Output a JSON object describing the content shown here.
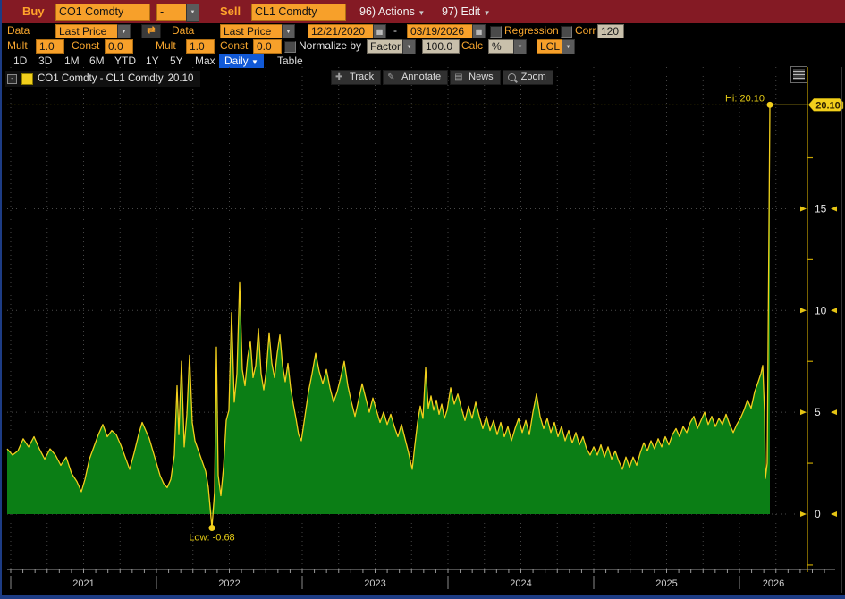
{
  "toolbar_row1": {
    "buy_label": "Buy",
    "buy_value": "CO1 Comdty",
    "spread_operator": "-",
    "sell_label": "Sell",
    "sell_value": "CL1 Comdty",
    "actions_label": "96) Actions",
    "edit_label": "97) Edit"
  },
  "toolbar_row2": {
    "data1_label": "Data",
    "data1_value": "Last Price",
    "swap_icon": "⇄",
    "data2_label": "Data",
    "data2_value": "Last Price",
    "date_from": "12/21/2020",
    "date_separator": "-",
    "date_to": "03/19/2026",
    "regression_label": "Regression",
    "corr_label": "Corr",
    "corr_value": "120"
  },
  "toolbar_row3": {
    "mult1_label": "Mult",
    "mult1_value": "1.0",
    "const1_label": "Const",
    "const1_value": "0.0",
    "mult2_label": "Mult",
    "mult2_value": "1.0",
    "const2_label": "Const",
    "const2_value": "0.0",
    "normalize_label": "Normalize by",
    "normalize_value": "Factor",
    "factor_value": "100.0",
    "calc_label": "Calc",
    "calc_value": "%",
    "lcl_value": "LCL"
  },
  "range_tabs": {
    "items": [
      "1D",
      "3D",
      "1M",
      "6M",
      "YTD",
      "1Y",
      "5Y",
      "Max"
    ],
    "period_selected": "Daily",
    "table_label": "Table"
  },
  "chart_toolbar": {
    "track_label": "Track",
    "annotate_label": "Annotate",
    "news_label": "News",
    "zoom_label": "Zoom"
  },
  "legend": {
    "series_label": "CO1 Comdty - CL1 Comdty",
    "last_value": "20.10"
  },
  "chart_data": {
    "type": "area",
    "title": "CO1 Comdty - CL1 Comdty spread (Brent minus WTI front-month)",
    "x_range": [
      "12/21/2020",
      "03/19/2026"
    ],
    "years": [
      "2021",
      "2022",
      "2023",
      "2024",
      "2025",
      "2026"
    ],
    "y_ticks": [
      0,
      5,
      10,
      15
    ],
    "y_minor_ticks": [
      -2.5,
      2.5,
      7.5,
      12.5,
      17.5
    ],
    "ylim": [
      -2.7,
      21.9
    ],
    "grid": "quarterly-vertical, major-horizontal, dotted",
    "hi": {
      "label": "Hi: 20.10",
      "value": 20.1,
      "axis_tag": "20.10"
    },
    "low": {
      "label": "Low: -0.68",
      "value": -0.68
    },
    "last_value": 20.1,
    "line_color": "#f2cf1c",
    "fill_color": "#0b7e15",
    "axis_color": "#c7a400",
    "points": [
      [
        0,
        3.2
      ],
      [
        6,
        2.9
      ],
      [
        12,
        3.1
      ],
      [
        18,
        3.7
      ],
      [
        24,
        3.3
      ],
      [
        30,
        3.8
      ],
      [
        36,
        3.2
      ],
      [
        42,
        2.7
      ],
      [
        48,
        3.2
      ],
      [
        54,
        2.9
      ],
      [
        60,
        2.4
      ],
      [
        66,
        2.8
      ],
      [
        72,
        2.0
      ],
      [
        78,
        1.6
      ],
      [
        83,
        1.1
      ],
      [
        87,
        1.7
      ],
      [
        92,
        2.7
      ],
      [
        97,
        3.3
      ],
      [
        102,
        3.9
      ],
      [
        107,
        4.4
      ],
      [
        112,
        3.8
      ],
      [
        117,
        4.1
      ],
      [
        122,
        3.9
      ],
      [
        127,
        3.4
      ],
      [
        132,
        2.8
      ],
      [
        137,
        2.2
      ],
      [
        142,
        3.0
      ],
      [
        147,
        3.9
      ],
      [
        151,
        4.5
      ],
      [
        155,
        4.1
      ],
      [
        159,
        3.7
      ],
      [
        163,
        3.1
      ],
      [
        167,
        2.5
      ],
      [
        171,
        1.9
      ],
      [
        175,
        1.5
      ],
      [
        179,
        1.3
      ],
      [
        183,
        1.7
      ],
      [
        187,
        2.9
      ],
      [
        190,
        6.3
      ],
      [
        192,
        3.9
      ],
      [
        195,
        7.5
      ],
      [
        198,
        3.3
      ],
      [
        201,
        4.9
      ],
      [
        204,
        7.8
      ],
      [
        207,
        4.5
      ],
      [
        210,
        3.6
      ],
      [
        214,
        3.1
      ],
      [
        218,
        2.6
      ],
      [
        222,
        2.1
      ],
      [
        225,
        1.3
      ],
      [
        229,
        -0.68
      ],
      [
        232,
        1.1
      ],
      [
        234,
        8.2
      ],
      [
        236,
        1.9
      ],
      [
        239,
        0.9
      ],
      [
        242,
        2.3
      ],
      [
        245,
        4.6
      ],
      [
        248,
        5.1
      ],
      [
        251,
        9.9
      ],
      [
        254,
        5.5
      ],
      [
        257,
        6.9
      ],
      [
        260,
        11.4
      ],
      [
        263,
        7.1
      ],
      [
        266,
        6.3
      ],
      [
        269,
        7.7
      ],
      [
        272,
        8.5
      ],
      [
        275,
        6.7
      ],
      [
        278,
        7.3
      ],
      [
        281,
        9.1
      ],
      [
        284,
        6.9
      ],
      [
        287,
        6.1
      ],
      [
        290,
        7.1
      ],
      [
        293,
        8.9
      ],
      [
        296,
        7.4
      ],
      [
        299,
        6.7
      ],
      [
        302,
        7.9
      ],
      [
        305,
        8.8
      ],
      [
        308,
        7.3
      ],
      [
        311,
        6.5
      ],
      [
        314,
        7.4
      ],
      [
        317,
        6.2
      ],
      [
        320,
        5.4
      ],
      [
        323,
        4.7
      ],
      [
        326,
        3.9
      ],
      [
        329,
        3.6
      ],
      [
        333,
        4.8
      ],
      [
        337,
        6.0
      ],
      [
        341,
        6.9
      ],
      [
        345,
        7.9
      ],
      [
        349,
        7.0
      ],
      [
        353,
        6.4
      ],
      [
        357,
        7.1
      ],
      [
        361,
        6.2
      ],
      [
        365,
        5.5
      ],
      [
        369,
        6.0
      ],
      [
        373,
        6.7
      ],
      [
        377,
        7.5
      ],
      [
        381,
        6.3
      ],
      [
        385,
        5.5
      ],
      [
        389,
        4.8
      ],
      [
        393,
        5.6
      ],
      [
        397,
        6.4
      ],
      [
        401,
        5.7
      ],
      [
        405,
        5.0
      ],
      [
        409,
        5.7
      ],
      [
        413,
        5.1
      ],
      [
        417,
        4.5
      ],
      [
        421,
        5.0
      ],
      [
        425,
        4.4
      ],
      [
        429,
        4.9
      ],
      [
        433,
        4.3
      ],
      [
        437,
        3.8
      ],
      [
        441,
        4.4
      ],
      [
        445,
        3.7
      ],
      [
        449,
        3.0
      ],
      [
        453,
        2.2
      ],
      [
        456,
        3.4
      ],
      [
        459,
        4.5
      ],
      [
        462,
        5.3
      ],
      [
        465,
        4.7
      ],
      [
        468,
        7.2
      ],
      [
        471,
        5.2
      ],
      [
        474,
        5.8
      ],
      [
        477,
        5.1
      ],
      [
        480,
        5.6
      ],
      [
        483,
        4.9
      ],
      [
        486,
        5.4
      ],
      [
        489,
        4.7
      ],
      [
        492,
        5.1
      ],
      [
        496,
        6.2
      ],
      [
        500,
        5.4
      ],
      [
        504,
        5.9
      ],
      [
        508,
        5.2
      ],
      [
        512,
        4.6
      ],
      [
        516,
        5.3
      ],
      [
        520,
        4.7
      ],
      [
        524,
        5.5
      ],
      [
        528,
        4.8
      ],
      [
        532,
        4.2
      ],
      [
        536,
        4.8
      ],
      [
        540,
        4.1
      ],
      [
        544,
        4.6
      ],
      [
        548,
        3.9
      ],
      [
        552,
        4.5
      ],
      [
        556,
        3.8
      ],
      [
        560,
        4.3
      ],
      [
        564,
        3.6
      ],
      [
        568,
        4.2
      ],
      [
        572,
        4.7
      ],
      [
        576,
        4.0
      ],
      [
        580,
        4.6
      ],
      [
        584,
        3.9
      ],
      [
        588,
        5.0
      ],
      [
        592,
        5.9
      ],
      [
        596,
        4.8
      ],
      [
        600,
        4.2
      ],
      [
        604,
        4.7
      ],
      [
        608,
        4.0
      ],
      [
        612,
        4.5
      ],
      [
        616,
        3.8
      ],
      [
        620,
        4.3
      ],
      [
        624,
        3.6
      ],
      [
        628,
        4.1
      ],
      [
        632,
        3.5
      ],
      [
        636,
        4.0
      ],
      [
        640,
        3.4
      ],
      [
        644,
        3.8
      ],
      [
        648,
        3.2
      ],
      [
        652,
        2.9
      ],
      [
        656,
        3.3
      ],
      [
        660,
        2.9
      ],
      [
        664,
        3.4
      ],
      [
        668,
        2.8
      ],
      [
        672,
        3.3
      ],
      [
        676,
        2.7
      ],
      [
        680,
        3.1
      ],
      [
        684,
        2.6
      ],
      [
        688,
        2.2
      ],
      [
        692,
        2.8
      ],
      [
        696,
        2.3
      ],
      [
        700,
        2.8
      ],
      [
        704,
        2.4
      ],
      [
        708,
        3.0
      ],
      [
        712,
        3.5
      ],
      [
        716,
        3.1
      ],
      [
        720,
        3.6
      ],
      [
        724,
        3.2
      ],
      [
        728,
        3.7
      ],
      [
        732,
        3.3
      ],
      [
        736,
        3.8
      ],
      [
        740,
        3.4
      ],
      [
        744,
        3.9
      ],
      [
        748,
        4.2
      ],
      [
        752,
        3.8
      ],
      [
        756,
        4.3
      ],
      [
        760,
        4.0
      ],
      [
        764,
        4.5
      ],
      [
        768,
        4.8
      ],
      [
        772,
        4.2
      ],
      [
        776,
        4.6
      ],
      [
        780,
        5.0
      ],
      [
        784,
        4.4
      ],
      [
        788,
        4.8
      ],
      [
        792,
        4.3
      ],
      [
        796,
        4.7
      ],
      [
        800,
        4.4
      ],
      [
        804,
        4.9
      ],
      [
        808,
        4.4
      ],
      [
        812,
        4.0
      ],
      [
        816,
        4.4
      ],
      [
        820,
        4.7
      ],
      [
        824,
        5.1
      ],
      [
        828,
        5.6
      ],
      [
        832,
        5.2
      ],
      [
        836,
        6.0
      ],
      [
        840,
        6.5
      ],
      [
        843,
        6.9
      ],
      [
        845,
        7.3
      ],
      [
        847,
        5.0
      ],
      [
        848,
        1.75
      ],
      [
        850,
        2.5
      ],
      [
        853,
        20.1
      ]
    ]
  }
}
